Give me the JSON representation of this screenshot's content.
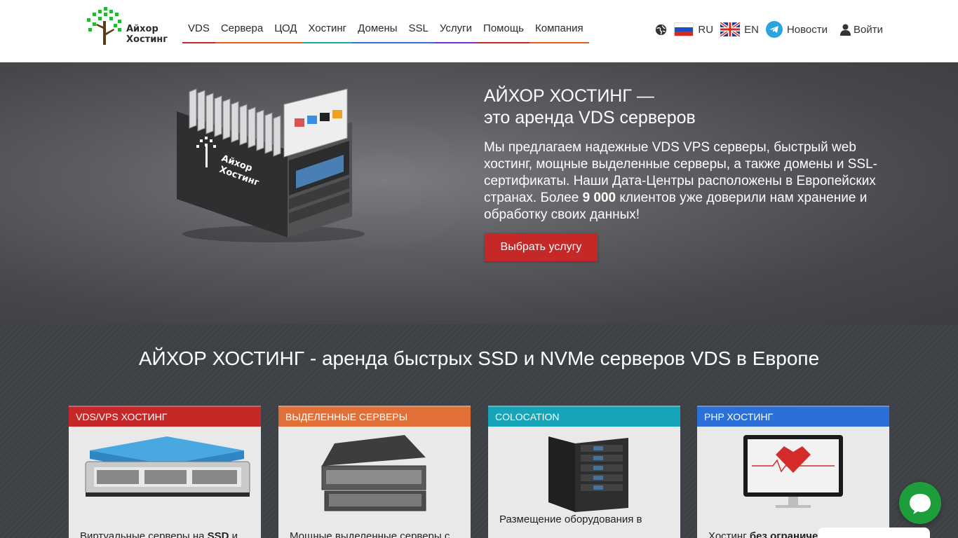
{
  "header": {
    "logo": {
      "line1": "Айхор",
      "line2": "Хостинг",
      "tree_color": "#2bb33c",
      "trunk_color": "#5b3a1e"
    },
    "nav": [
      {
        "label": "VDS",
        "color": "#c62828"
      },
      {
        "label": "Сервера",
        "color": "#e65a1a"
      },
      {
        "label": "ЦОД",
        "color": "#e65a1a"
      },
      {
        "label": "Хостинг",
        "color": "#1aa3b5"
      },
      {
        "label": "Домены",
        "color": "#2f6fd1"
      },
      {
        "label": "SSL",
        "color": "#2f6fd1"
      },
      {
        "label": "Услуги",
        "color": "#7a2fd1"
      },
      {
        "label": "Помощь",
        "color": "#c62828"
      },
      {
        "label": "Компания",
        "color": "#e65a1a"
      }
    ],
    "right": {
      "globe_icon": "globe-icon",
      "lang_ru": "RU",
      "lang_en": "EN",
      "news": "Новости",
      "login": "Войти"
    }
  },
  "hero": {
    "title_line1": "АЙХОР ХОСТИНГ —",
    "title_line2": "это аренда VDS серверов",
    "text_part1": "Мы предлагаем надежные VDS VPS серверы, быстрый web хостинг, мощные выделенные серверы, а также домены и SSL-сертификаты. Наши Дата-Центры расположены в Европейских странах. Более ",
    "text_bold": "9 000",
    "text_part2": " клиентов уже доверили нам хранение и обработку своих данных!",
    "button": "Выбрать услугу",
    "accent": "#c62828"
  },
  "section": {
    "title": "АЙХОР ХОСТИНГ - аренда быстрых SSD и NVMe серверов VDS в Европе",
    "cards": [
      {
        "title": "VDS/VPS ХОСТИНГ",
        "color": "#c62828",
        "text_part1": "Виртуальные серверы на ",
        "text_bold": "SSD",
        "text_part2": " и"
      },
      {
        "title": "ВЫДЕЛЕННЫЕ СЕРВЕРЫ",
        "color": "#e07038",
        "text_part1": "Мощные выделенные серверы с",
        "text_bold": "",
        "text_part2": ""
      },
      {
        "title": "COLOCATION",
        "color": "#16a4b8",
        "text_part1": "Размещение оборудования в",
        "text_bold": "",
        "text_part2": ""
      },
      {
        "title": "PHP ХОСТИНГ",
        "color": "#2b6fd9",
        "text_part1": "Хостинг ",
        "text_bold": "без ограничений",
        "text_part2": ""
      }
    ]
  },
  "chat": {
    "color": "#1e9e3a"
  }
}
